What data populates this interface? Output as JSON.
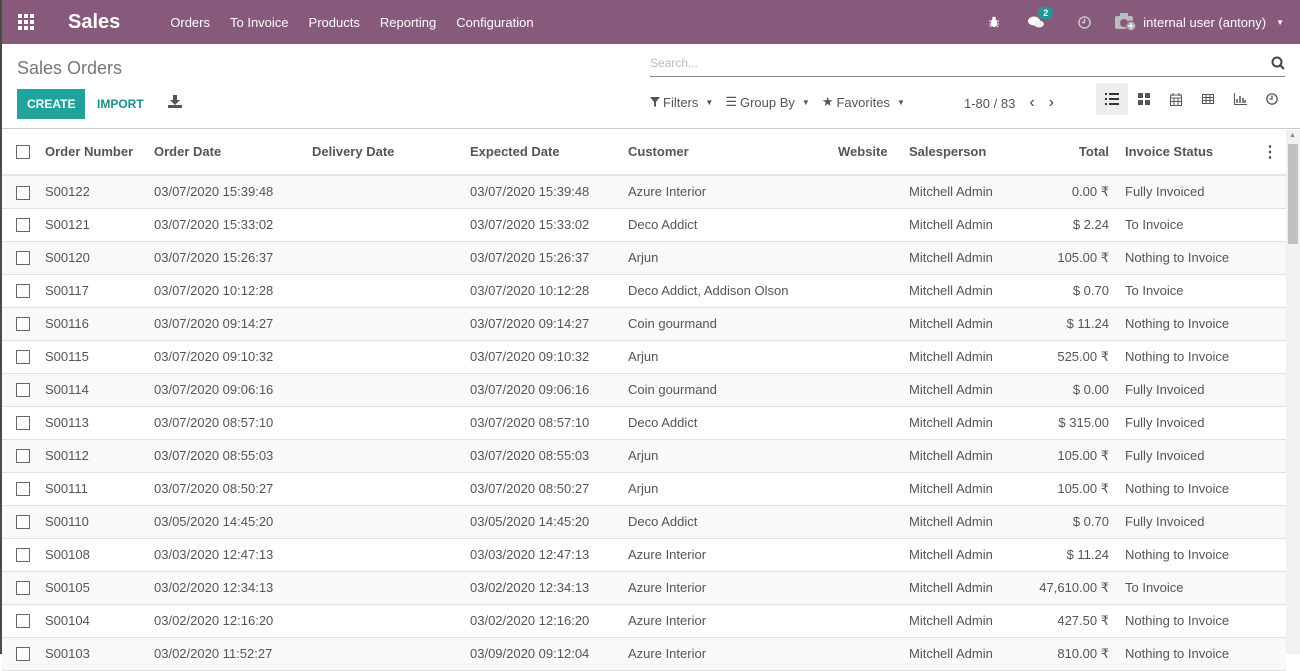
{
  "navbar": {
    "app_title": "Sales",
    "menu": [
      "Orders",
      "To Invoice",
      "Products",
      "Reporting",
      "Configuration"
    ],
    "messages_count": "2",
    "user": "internal user (antony)",
    "color": "#875a7b"
  },
  "control": {
    "title": "Sales Orders",
    "create_label": "CREATE",
    "import_label": "IMPORT",
    "search_placeholder": "Search...",
    "filters_label": "Filters",
    "groupby_label": "Group By",
    "favorites_label": "Favorites",
    "pager": "1-80 / 83",
    "accent": "#21a29d"
  },
  "table": {
    "headers": [
      "Order Number",
      "Order Date",
      "Delivery Date",
      "Expected Date",
      "Customer",
      "Website",
      "Salesperson",
      "Total",
      "Invoice Status"
    ],
    "rows": [
      [
        "S00122",
        "03/07/2020 15:39:48",
        "",
        "03/07/2020 15:39:48",
        "Azure Interior",
        "",
        "Mitchell Admin",
        "0.00 ₹",
        "Fully Invoiced"
      ],
      [
        "S00121",
        "03/07/2020 15:33:02",
        "",
        "03/07/2020 15:33:02",
        "Deco Addict",
        "",
        "Mitchell Admin",
        "$ 2.24",
        "To Invoice"
      ],
      [
        "S00120",
        "03/07/2020 15:26:37",
        "",
        "03/07/2020 15:26:37",
        "Arjun",
        "",
        "Mitchell Admin",
        "105.00 ₹",
        "Nothing to Invoice"
      ],
      [
        "S00117",
        "03/07/2020 10:12:28",
        "",
        "03/07/2020 10:12:28",
        "Deco Addict, Addison Olson",
        "",
        "Mitchell Admin",
        "$ 0.70",
        "To Invoice"
      ],
      [
        "S00116",
        "03/07/2020 09:14:27",
        "",
        "03/07/2020 09:14:27",
        "Coin gourmand",
        "",
        "Mitchell Admin",
        "$ 11.24",
        "Nothing to Invoice"
      ],
      [
        "S00115",
        "03/07/2020 09:10:32",
        "",
        "03/07/2020 09:10:32",
        "Arjun",
        "",
        "Mitchell Admin",
        "525.00 ₹",
        "Nothing to Invoice"
      ],
      [
        "S00114",
        "03/07/2020 09:06:16",
        "",
        "03/07/2020 09:06:16",
        "Coin gourmand",
        "",
        "Mitchell Admin",
        "$ 0.00",
        "Fully Invoiced"
      ],
      [
        "S00113",
        "03/07/2020 08:57:10",
        "",
        "03/07/2020 08:57:10",
        "Deco Addict",
        "",
        "Mitchell Admin",
        "$ 315.00",
        "Fully Invoiced"
      ],
      [
        "S00112",
        "03/07/2020 08:55:03",
        "",
        "03/07/2020 08:55:03",
        "Arjun",
        "",
        "Mitchell Admin",
        "105.00 ₹",
        "Fully Invoiced"
      ],
      [
        "S00111",
        "03/07/2020 08:50:27",
        "",
        "03/07/2020 08:50:27",
        "Arjun",
        "",
        "Mitchell Admin",
        "105.00 ₹",
        "Nothing to Invoice"
      ],
      [
        "S00110",
        "03/05/2020 14:45:20",
        "",
        "03/05/2020 14:45:20",
        "Deco Addict",
        "",
        "Mitchell Admin",
        "$ 0.70",
        "Fully Invoiced"
      ],
      [
        "S00108",
        "03/03/2020 12:47:13",
        "",
        "03/03/2020 12:47:13",
        "Azure Interior",
        "",
        "Mitchell Admin",
        "$ 11.24",
        "Nothing to Invoice"
      ],
      [
        "S00105",
        "03/02/2020 12:34:13",
        "",
        "03/02/2020 12:34:13",
        "Azure Interior",
        "",
        "Mitchell Admin",
        "47,610.00 ₹",
        "To Invoice"
      ],
      [
        "S00104",
        "03/02/2020 12:16:20",
        "",
        "03/02/2020 12:16:20",
        "Azure Interior",
        "",
        "Mitchell Admin",
        "427.50 ₹",
        "Nothing to Invoice"
      ],
      [
        "S00103",
        "03/02/2020 11:52:27",
        "",
        "03/09/2020 09:12:04",
        "Azure Interior",
        "",
        "Mitchell Admin",
        "810.00 ₹",
        "Nothing to Invoice"
      ]
    ]
  }
}
